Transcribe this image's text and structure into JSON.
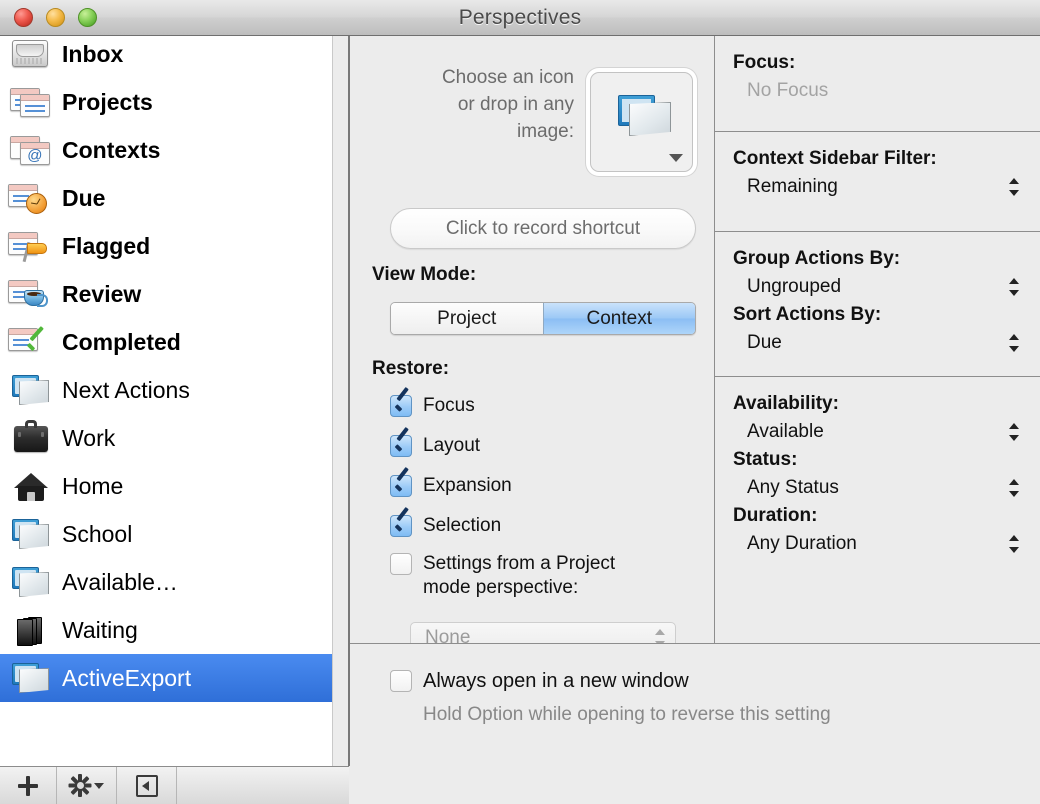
{
  "window": {
    "title": "Perspectives"
  },
  "sidebar": {
    "items": [
      {
        "label": "Inbox",
        "icon": "inbox-tray-icon",
        "builtin": true,
        "selected": false
      },
      {
        "label": "Projects",
        "icon": "projects-cards-icon",
        "builtin": true,
        "selected": false
      },
      {
        "label": "Contexts",
        "icon": "contexts-at-icon",
        "builtin": true,
        "selected": false
      },
      {
        "label": "Due",
        "icon": "due-clock-icon",
        "builtin": true,
        "selected": false
      },
      {
        "label": "Flagged",
        "icon": "flagged-flag-icon",
        "builtin": true,
        "selected": false
      },
      {
        "label": "Review",
        "icon": "review-cup-icon",
        "builtin": true,
        "selected": false
      },
      {
        "label": "Completed",
        "icon": "completed-check-icon",
        "builtin": true,
        "selected": false
      },
      {
        "label": "Next Actions",
        "icon": "perspective-icon",
        "builtin": false,
        "selected": false
      },
      {
        "label": "Work",
        "icon": "briefcase-icon",
        "builtin": false,
        "selected": false
      },
      {
        "label": "Home",
        "icon": "house-icon",
        "builtin": false,
        "selected": false
      },
      {
        "label": "School",
        "icon": "perspective-icon",
        "builtin": false,
        "selected": false
      },
      {
        "label": "Available…",
        "icon": "perspective-icon",
        "builtin": false,
        "selected": false
      },
      {
        "label": "Waiting",
        "icon": "books-icon",
        "builtin": false,
        "selected": false
      },
      {
        "label": "ActiveExport",
        "icon": "perspective-icon",
        "builtin": false,
        "selected": true
      }
    ],
    "toolbar": {
      "add": "add-perspective-button",
      "action": "action-gear-button",
      "panel": "toggle-panel-button"
    },
    "selection_color": "#3b7dea"
  },
  "center": {
    "choose_icon_label": "Choose an icon\nor drop in any\nimage:",
    "choose_icon_line1": "Choose an icon",
    "choose_icon_line2": "or drop in any",
    "choose_icon_line3": "image:",
    "shortcut_button": "Click to record shortcut",
    "view_mode_label": "View Mode:",
    "view_mode_options": [
      "Project",
      "Context"
    ],
    "view_mode_selected": "Context",
    "restore_label": "Restore:",
    "restore": [
      {
        "label": "Focus",
        "checked": true
      },
      {
        "label": "Layout",
        "checked": true
      },
      {
        "label": "Expansion",
        "checked": true
      },
      {
        "label": "Selection",
        "checked": true
      }
    ],
    "settings_checkbox": {
      "line1": "Settings from a Project",
      "line2": "mode perspective:",
      "checked": false
    },
    "settings_select_value": "None"
  },
  "right": {
    "sections": [
      {
        "fields": [
          {
            "head": "Focus:",
            "value": "No Focus",
            "popup": false,
            "dim": true
          }
        ]
      },
      {
        "fields": [
          {
            "head": "Context Sidebar Filter:",
            "value": "Remaining",
            "popup": true,
            "dim": false
          }
        ]
      },
      {
        "fields": [
          {
            "head": "Group Actions By:",
            "value": "Ungrouped",
            "popup": true,
            "dim": false
          },
          {
            "head": "Sort Actions By:",
            "value": "Due",
            "popup": true,
            "dim": false
          }
        ]
      },
      {
        "fields": [
          {
            "head": "Availability:",
            "value": "Available",
            "popup": true,
            "dim": false
          },
          {
            "head": "Status:",
            "value": "Any Status",
            "popup": true,
            "dim": false
          },
          {
            "head": "Duration:",
            "value": "Any Duration",
            "popup": true,
            "dim": false
          }
        ]
      }
    ]
  },
  "footer": {
    "always_open_label": "Always open in a new window",
    "always_open_checked": false,
    "hold_note": "Hold Option while opening to reverse this setting"
  }
}
